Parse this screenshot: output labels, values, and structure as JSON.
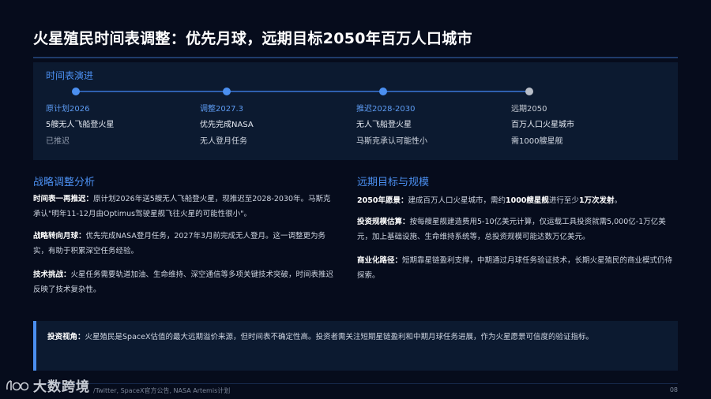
{
  "title": "火星殖民时间表调整：优先月球，远期目标2050年百万人口城市",
  "timeline": {
    "heading": "时间表演进",
    "items": [
      {
        "label": "原计划2026",
        "line1": "5艘无人飞船登火星",
        "line2": "已推迟"
      },
      {
        "label": "调整2027.3",
        "line1": "优先完成NASA",
        "line2": "无人登月任务"
      },
      {
        "label": "推迟2028-2030",
        "line1": "无人飞船登火星",
        "line2": "马斯克承认可能性小"
      },
      {
        "label": "远期2050",
        "line1": "百万人口火星城市",
        "line2": "需1000艘星舰"
      }
    ]
  },
  "left": {
    "heading": "战略调整分析",
    "p1_bold": "时间表一再推迟：",
    "p1_text": "原计划2026年送5艘无人飞船登火星，现推迟至2028-2030年。马斯克承认\"明年11-12月由Optimus驾驶星舰飞往火星的可能性很小\"。",
    "p2_bold": "战略转向月球：",
    "p2_text": "优先完成NASA登月任务，2027年3月前完成无人登月。这一调整更为务实，有助于积累深空任务经验。",
    "p3_bold": "技术挑战：",
    "p3_text": "火星任务需要轨道加油、生命维持、深空通信等多项关键技术突破，时间表推迟反映了技术复杂性。"
  },
  "right": {
    "heading": "远期目标与规模",
    "p1_bold": "2050年愿景：",
    "p1_text_a": "建成百万人口火星城市，需约",
    "p1_bold2": "1000艘星舰",
    "p1_text_b": "进行至少",
    "p1_bold3": "1万次发射",
    "p1_text_c": "。",
    "p2_bold": "投资规模估算：",
    "p2_text": "按每艘星舰建造费用5-10亿美元计算，仅运载工具投资就需5,000亿-1万亿美元，加上基础设施、生命维持系统等，总投资规模可能达数万亿美元。",
    "p3_bold": "商业化路径：",
    "p3_text": "短期靠星链盈利支撑，中期通过月球任务验证技术，长期火星殖民的商业模式仍待探索。"
  },
  "insight": {
    "bold": "投资视角：",
    "text": "火星殖民是SpaceX估值的最大远期溢价来源，但时间表不确定性高。投资者需关注短期星链盈利和中期月球任务进展，作为火星愿景可信度的验证指标。"
  },
  "footer": {
    "source": "/Twitter, SpaceX官方公告, NASA Artemis计划",
    "page": "08"
  },
  "watermark": {
    "text": "大数跨境"
  },
  "colors": {
    "accent": "#4b8ff0",
    "background": "#060c1c",
    "panel": "#0c1a30"
  }
}
